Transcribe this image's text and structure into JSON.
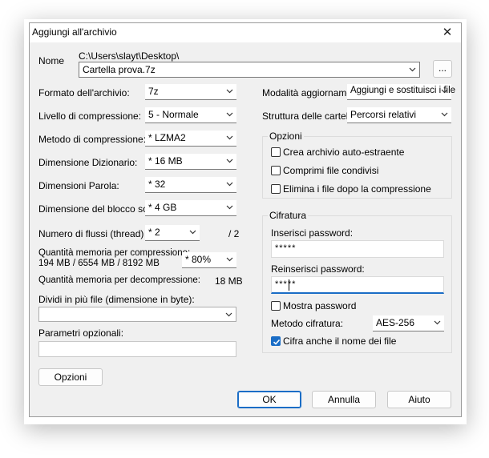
{
  "window": {
    "title": "Aggiungi all'archivio",
    "close_glyph": "✕"
  },
  "name": {
    "label": "Nome",
    "path": "C:\\Users\\slayt\\Desktop\\",
    "value": "Cartella prova.7z",
    "browse_label": "..."
  },
  "left": {
    "format_label": "Formato dell'archivio:",
    "format_value": "7z",
    "level_label": "Livello di compressione:",
    "level_value": "5 - Normale",
    "method_label": "Metodo di compressione:",
    "method_value": "* LZMA2",
    "dict_label": "Dimensione Dizionario:",
    "dict_value": "* 16 MB",
    "word_label": "Dimensioni Parola:",
    "word_value": "* 32",
    "solid_label": "Dimensione del blocco solido:",
    "solid_value": "* 4 GB",
    "threads_label": "Numero di flussi (thread) CPU:",
    "threads_value": "* 2",
    "threads_max": "/ 2",
    "mem_comp_label": "Quantità memoria per compressione:",
    "mem_comp_values": "194 MB / 6554 MB / 8192 MB",
    "mem_comp_select": "* 80%",
    "mem_decomp_label": "Quantità memoria per decompressione:",
    "mem_decomp_value": "18 MB",
    "split_label": "Dividi in più file (dimensione in byte):",
    "split_value": "",
    "params_label": "Parametri opzionali:",
    "params_value": "",
    "options_button": "Opzioni"
  },
  "right": {
    "update_label": "Modalità aggiornamento:",
    "update_value": "Aggiungi e sostituisci i file",
    "paths_label": "Struttura delle cartelle:",
    "paths_value": "Percorsi relativi",
    "options_group": "Opzioni",
    "opt_sfx": "Crea archivio auto-estraente",
    "opt_sfx_checked": false,
    "opt_shared": "Comprimi file condivisi",
    "opt_shared_checked": false,
    "opt_delete": "Elimina i file dopo la compressione",
    "opt_delete_checked": false,
    "encryption_group": "Cifratura",
    "pw_label": "Inserisci password:",
    "pw_value": "*****",
    "pw2_label": "Reinserisci password:",
    "pw2_value": "*****",
    "show_pw": "Mostra password",
    "show_pw_checked": false,
    "enc_method_label": "Metodo cifratura:",
    "enc_method_value": "AES-256",
    "enc_names": "Cifra anche il nome dei file",
    "enc_names_checked": true
  },
  "buttons": {
    "ok": "OK",
    "cancel": "Annulla",
    "help": "Aiuto"
  },
  "colors": {
    "accent": "#1a6dc6"
  }
}
